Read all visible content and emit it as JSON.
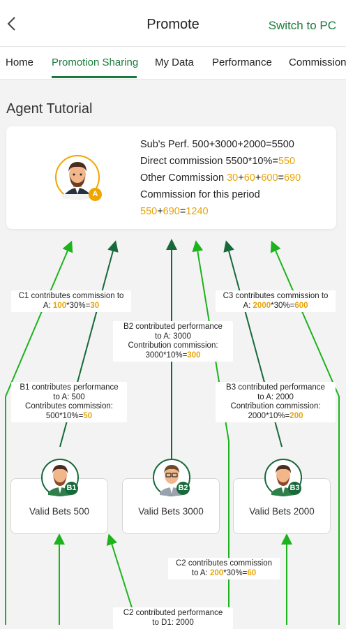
{
  "header": {
    "title": "Promote",
    "switch_label": "Switch to PC"
  },
  "tabs": [
    "Home",
    "Promotion Sharing",
    "My Data",
    "Performance",
    "Commission"
  ],
  "active_tab": "Promotion Sharing",
  "section_title": "Agent Tutorial",
  "summary": {
    "line1": "Sub's Perf. 500+3000+2000=5500",
    "line2_prefix": "Direct commission 5500*10%=",
    "line2_value": "550",
    "line3_prefix": "Other Commission ",
    "line3_a": "30",
    "line3_b": "60",
    "line3_c": "600",
    "line3_total": "690",
    "line4": "Commission for this period",
    "line5_a": "550",
    "line5_b": "690",
    "line5_total": "1240",
    "plus": "+",
    "equals": "="
  },
  "badges": {
    "a": "A",
    "b1": "B1",
    "b2": "B2",
    "b3": "B3"
  },
  "boxes": {
    "b1": "Valid Bets 500",
    "b2": "Valid Bets 3000",
    "b3": "Valid Bets 2000"
  },
  "labels": {
    "c1_l1": "C1 contributes commission to",
    "c1_pre": "A: ",
    "c1_v1": "100",
    "c1_mid": "*30%=",
    "c1_v2": "30",
    "c3_l1": "C3 contributes commission to",
    "c3_pre": "A: ",
    "c3_v1": "2000",
    "c3_mid": "*30%=",
    "c3_v2": "600",
    "b2_l1": "B2 contributed performance",
    "b2_l2": "to A: 3000",
    "b2_l3": "Contribution commission:",
    "b2_pre": "3000*10%=",
    "b2_v": "300",
    "b1_l1": "B1 contributes performance",
    "b1_l2": "to A: 500",
    "b1_l3": "Contributes commission:",
    "b1_pre": "500*10%=",
    "b1_v": "50",
    "b3_l1": "B3 contributed performance",
    "b3_l2": "to A: 2000",
    "b3_l3": "Contribution commission:",
    "b3_pre": "2000*10%=",
    "b3_v": "200",
    "c2_l1": "C2 contributes commission",
    "c2_pre": "to A: ",
    "c2_v1": "200",
    "c2_mid": "*30%=",
    "c2_v2": "60",
    "c2p_l1": "C2 contributed performance",
    "c2p_l2": "to D1: 2000"
  },
  "colors": {
    "brand": "#1c7a3e",
    "highlight": "#e8a30a",
    "arrow_light": "#1db31d",
    "arrow_dark": "#17693a"
  }
}
